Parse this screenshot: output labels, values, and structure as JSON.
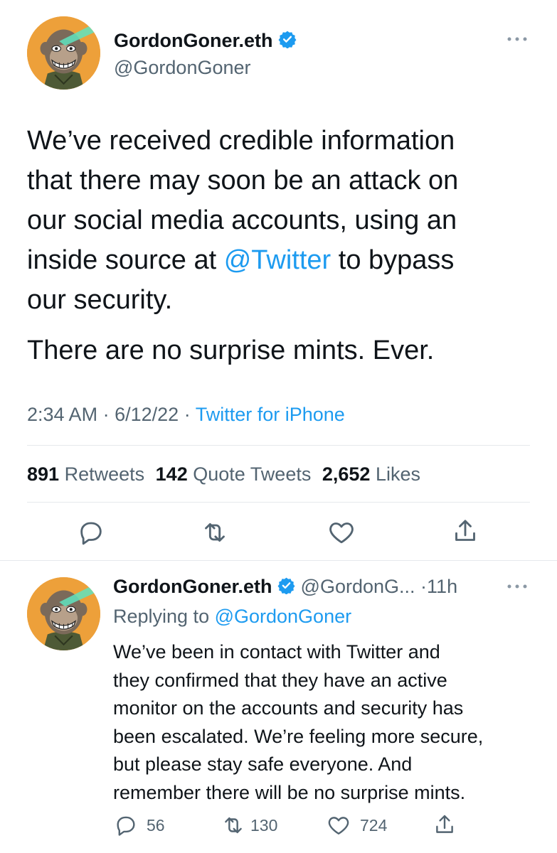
{
  "main_tweet": {
    "display_name": "GordonGoner.eth",
    "handle": "@GordonGoner",
    "lines": [
      {
        "parts": [
          {
            "t": "We’ve received credible information"
          }
        ]
      },
      {
        "parts": [
          {
            "t": "that there may soon be an attack on"
          }
        ]
      },
      {
        "parts": [
          {
            "t": "our social media accounts, using an"
          }
        ]
      },
      {
        "parts": [
          {
            "t": "inside source at "
          },
          {
            "t": "@Twitter",
            "link": true
          },
          {
            "t": " to bypass"
          }
        ]
      },
      {
        "parts": [
          {
            "t": "our security."
          }
        ]
      }
    ],
    "line_last": "There are no surprise mints. Ever.",
    "time": "2:34 AM",
    "date": "6/12/22",
    "sep": "·",
    "source": "Twitter for iPhone",
    "stats": {
      "retweets_count": "891",
      "retweets_label": "Retweets",
      "quotes_count": "142",
      "quotes_label": "Quote Tweets",
      "likes_count": "2,652",
      "likes_label": "Likes"
    },
    "icons": [
      "reply-icon",
      "retweet-icon",
      "like-icon",
      "share-icon"
    ]
  },
  "reply_tweet": {
    "display_name": "GordonGoner.eth",
    "handle": "@GordonG...",
    "sep": "·",
    "age": "11h",
    "replying_prefix": "Replying to ",
    "replying_to": "@GordonGoner",
    "lines": [
      "We’ve been in contact with Twitter and",
      "they confirmed that they have an active",
      "monitor on the accounts and security has",
      "been escalated. We’re feeling more secure,",
      "but please stay safe everyone. And",
      "remember there will be no surprise mints."
    ],
    "replies": "56",
    "retweets": "130",
    "likes": "724"
  },
  "colors": {
    "accent": "#1d9bf0",
    "avatar_bg": "#eda03a",
    "text": "#0f1419",
    "muted": "#536471",
    "divider": "#e6e9ec"
  }
}
